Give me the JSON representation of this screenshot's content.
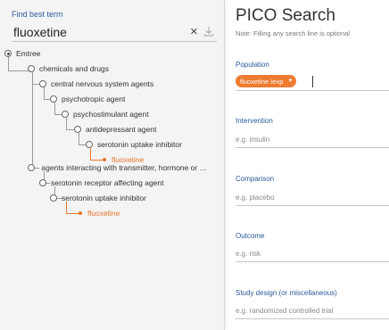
{
  "left_panel": {
    "find_label": "Find best term",
    "search_value": "fluoxetine",
    "clear_glyph": "×",
    "tree": [
      {
        "label": "Emtree",
        "kind": "root"
      },
      {
        "label": "chemicals and drugs",
        "kind": "branch"
      },
      {
        "label": "central nervous system agents",
        "kind": "branch"
      },
      {
        "label": "psychotropic agent",
        "kind": "branch"
      },
      {
        "label": "psychostimulant agent",
        "kind": "branch"
      },
      {
        "label": "antidepressant agent",
        "kind": "branch"
      },
      {
        "label": "serotonin uptake inhibitor",
        "kind": "branch"
      },
      {
        "label": "fluoxetine",
        "kind": "leaf"
      },
      {
        "label": "agents interacting with transmitter, hormone or drug receptors",
        "kind": "branch"
      },
      {
        "label": "serotonin receptor affecting agent",
        "kind": "branch"
      },
      {
        "label": "serotonin uptake inhibitor",
        "kind": "branch"
      },
      {
        "label": "fluoxetine",
        "kind": "leaf"
      }
    ]
  },
  "pico": {
    "title": "PICO Search",
    "note": "Note: Filling any search line is optional",
    "population": {
      "label": "Population",
      "chip": "fluoxetine /exp",
      "chip_caret": "▼"
    },
    "intervention": {
      "label": "Intervention",
      "placeholder": "e.g. insulin"
    },
    "comparison": {
      "label": "Comparison",
      "placeholder": "e.g. placebo"
    },
    "outcome": {
      "label": "Outcome",
      "placeholder": "e.g. risk"
    },
    "study_design": {
      "label": "Study design (or miscellaneous)",
      "placeholder": "e.g. randomized controlled trial"
    }
  },
  "colors": {
    "accent_orange": "#ee7d32",
    "label_blue": "#2a5a9b",
    "panel_gray": "#f4f4f5"
  },
  "icons": {
    "clear": "close-icon",
    "download": "download-icon",
    "tree_node": "circle-node-icon",
    "tree_leaf": "dot-icon",
    "chip_dropdown": "caret-down-icon"
  }
}
